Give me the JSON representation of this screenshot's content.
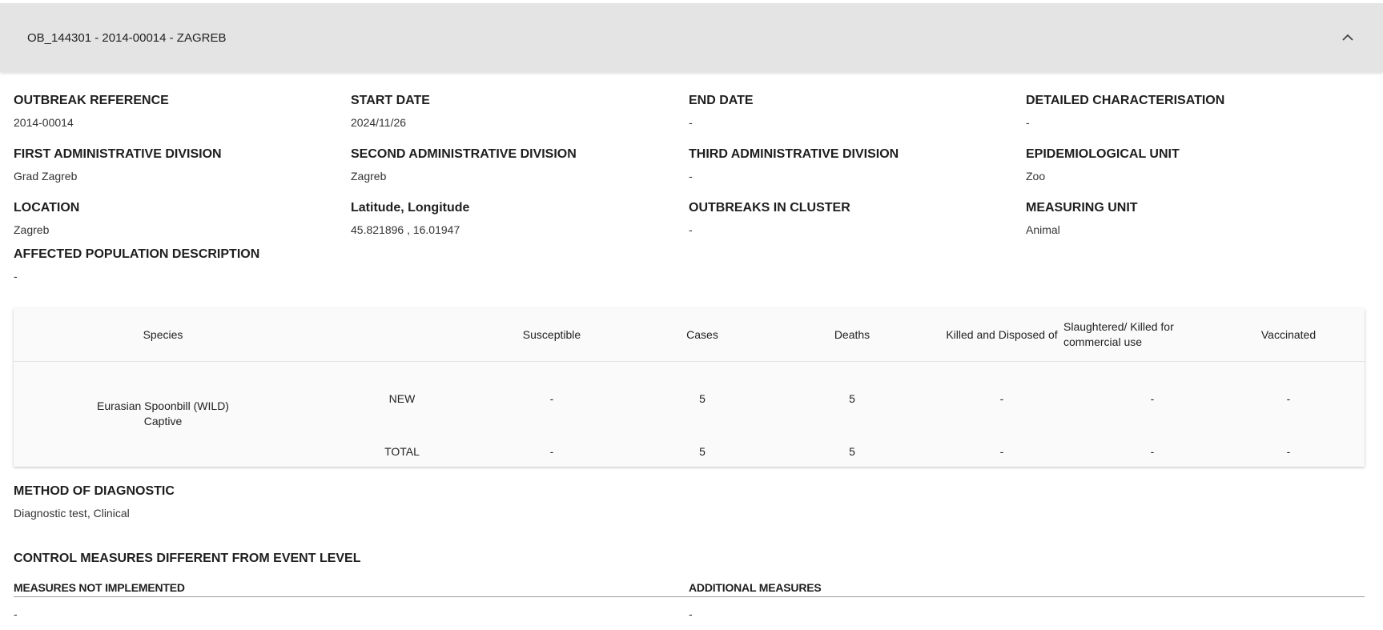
{
  "panel": {
    "title": "OB_144301 - 2014-00014 - ZAGREB",
    "collapse_icon": "chevron-up-icon"
  },
  "fields": {
    "outbreak_reference": {
      "label": "OUTBREAK REFERENCE",
      "value": "2014-00014"
    },
    "start_date": {
      "label": "START DATE",
      "value": "2024/11/26"
    },
    "end_date": {
      "label": "END DATE",
      "value": "-"
    },
    "detailed_characterisation": {
      "label": "DETAILED CHARACTERISATION",
      "value": "-"
    },
    "first_admin_division": {
      "label": "FIRST ADMINISTRATIVE DIVISION",
      "value": "Grad Zagreb"
    },
    "second_admin_division": {
      "label": "SECOND ADMINISTRATIVE DIVISION",
      "value": "Zagreb"
    },
    "third_admin_division": {
      "label": "THIRD ADMINISTRATIVE DIVISION",
      "value": "-"
    },
    "epidemiological_unit": {
      "label": "EPIDEMIOLOGICAL UNIT",
      "value": "Zoo"
    },
    "location": {
      "label": "LOCATION",
      "value": "Zagreb"
    },
    "lat_long": {
      "label": "Latitude, Longitude",
      "value": "45.821896 , 16.01947"
    },
    "outbreaks_in_cluster": {
      "label": "OUTBREAKS IN CLUSTER",
      "value": "-"
    },
    "measuring_unit": {
      "label": "MEASURING UNIT",
      "value": "Animal"
    },
    "affected_population": {
      "label": "AFFECTED POPULATION DESCRIPTION",
      "value": "-"
    }
  },
  "table": {
    "headers": {
      "species": "Species",
      "susceptible": "Susceptible",
      "cases": "Cases",
      "deaths": "Deaths",
      "killed": "Killed and Disposed of",
      "slaughtered": "Slaughtered/ Killed for commercial use",
      "vaccinated": "Vaccinated"
    },
    "species_name": "Eurasian Spoonbill (WILD)",
    "species_sub": "Captive",
    "rows": [
      {
        "label": "NEW",
        "susceptible": "-",
        "cases": "5",
        "deaths": "5",
        "killed": "-",
        "slaughtered": "-",
        "vaccinated": "-"
      },
      {
        "label": "TOTAL",
        "susceptible": "-",
        "cases": "5",
        "deaths": "5",
        "killed": "-",
        "slaughtered": "-",
        "vaccinated": "-"
      }
    ]
  },
  "method": {
    "label": "METHOD OF DIAGNOSTIC",
    "value": "Diagnostic test, Clinical"
  },
  "control": {
    "title": "CONTROL MEASURES DIFFERENT FROM EVENT LEVEL",
    "not_implemented_label": "MEASURES NOT IMPLEMENTED",
    "not_implemented_value": "-",
    "additional_label": "ADDITIONAL MEASURES",
    "additional_value": "-"
  }
}
